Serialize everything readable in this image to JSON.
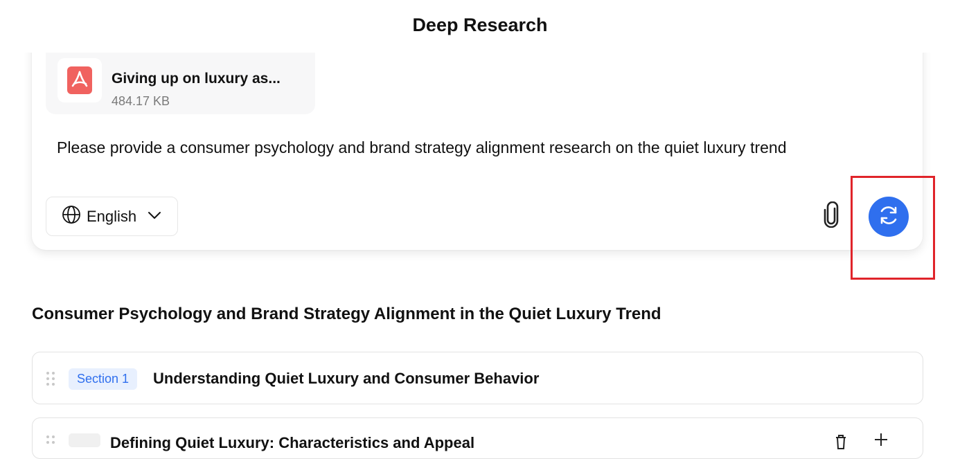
{
  "header": {
    "title": "Deep Research"
  },
  "input_card": {
    "attachment": {
      "name": "Giving up on luxury as...",
      "size": "484.17 KB",
      "icon": "pdf-icon"
    },
    "prompt": "Please provide a consumer psychology and brand strategy alignment research on the quiet luxury trend",
    "language": {
      "selected": "English",
      "icon": "globe-icon",
      "dropdown_icon": "chevron-down-icon"
    },
    "attach_icon": "paperclip-icon",
    "refresh_icon": "refresh-icon"
  },
  "outline": {
    "title": "Consumer Psychology and Brand Strategy Alignment in the Quiet Luxury Trend",
    "sections": [
      {
        "badge": "Section 1",
        "title": "Understanding Quiet Luxury and Consumer Behavior"
      }
    ],
    "subsections": [
      {
        "title": "Defining Quiet Luxury: Characteristics and Appeal"
      }
    ]
  },
  "colors": {
    "accent": "#2f6fee",
    "highlight": "#e0242a",
    "pdf": "#f0625f"
  }
}
